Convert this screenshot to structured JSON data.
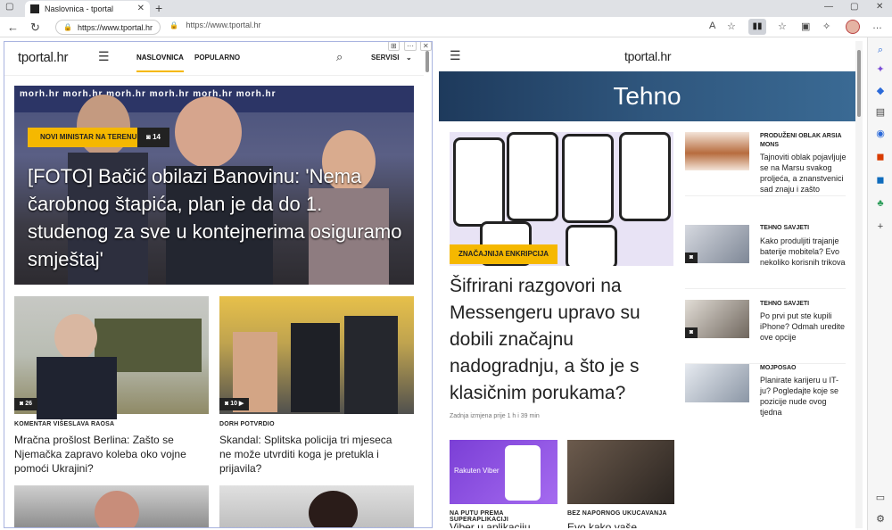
{
  "browser": {
    "tab_title": "Naslovnica - tportal",
    "url_left": "https://www.tportal.hr",
    "url_right": "https://www.tportal.hr"
  },
  "left": {
    "logo": "tportal.hr",
    "nav": [
      "NASLOVNICA",
      "POPULARNO",
      "SERVISI"
    ],
    "hero": {
      "tag": "NOVI MINISTAR NA TERENU",
      "count": "14",
      "title": "[FOTO] Bačić obilazi Banovinu: 'Nema čarobnog štapića, plan je da do 1. studenog za sve u kontejnerima osiguramo smještaj'",
      "banner": "morh.hr morh.hr morh.hr morh.hr morh.hr morh.hr"
    },
    "cards": [
      {
        "kicker": "KOMENTAR VIŠESLAVA RAOSA",
        "title": "Mračna prošlost Berlina: Zašto se Njemačka zapravo koleba oko vojne pomoći Ukrajini?",
        "count": "26"
      },
      {
        "kicker": "DORH POTVRDIO",
        "title": "Skandal: Splitska policija tri mjeseca ne može utvrditi koga je pretukla i prijavila?",
        "count": "10"
      }
    ]
  },
  "right": {
    "logo": "tportal.hr",
    "section": "Tehno",
    "main": {
      "tag": "ZNAČAJNIJA ENKRIPCIJA",
      "title": "Šifrirani razgovori na Messengeru upravo su dobili značajnu nadogradnju, a što je s klasičnim porukama?",
      "updated": "Zadnja izmjena prije 1 h i 39 min"
    },
    "side": [
      {
        "kicker": "PRODUŽENI OBLAK ARSIA MONS",
        "text": "Tajnoviti oblak pojavljuje se na Marsu svakog proljeća, a znanstvenici sad znaju i zašto"
      },
      {
        "kicker": "TEHNO SAVJETI",
        "text": "Kako produljiti trajanje baterije mobitela? Evo nekoliko korisnih trikova"
      },
      {
        "kicker": "TEHNO SAVJETI",
        "text": "Po prvi put ste kupili iPhone? Odmah uredite ove opcije"
      },
      {
        "kicker": "MOJPOSAO",
        "text": "Planirate karijeru u IT-ju? Pogledajte koje se pozicije nude ovog tjedna"
      }
    ],
    "bottom": [
      {
        "kicker": "NA PUTU PREMA SUPERAPLIKACIJI",
        "title": "Viber u aplikaciju",
        "brand": "Rakuten Viber"
      },
      {
        "kicker": "BEZ NAPORNOG UKUCAVANJA",
        "title": "Evo kako vaše"
      }
    ]
  }
}
